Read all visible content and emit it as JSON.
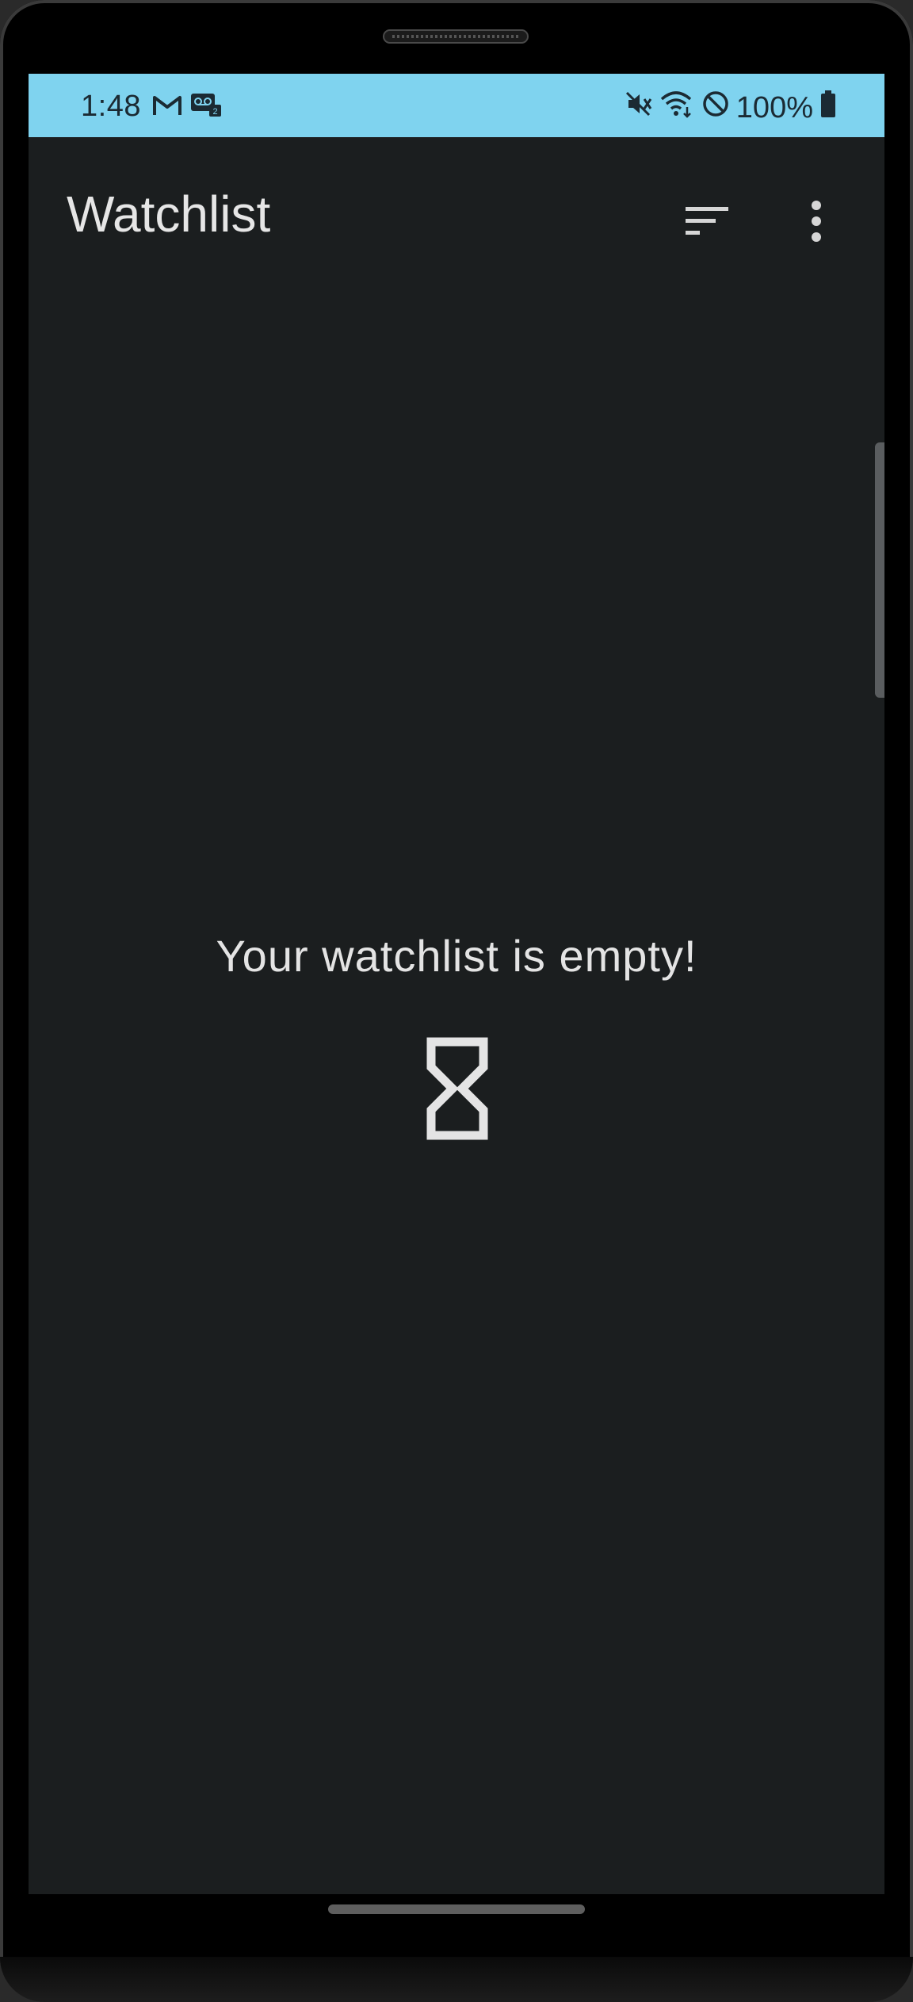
{
  "status_bar": {
    "time": "1:48",
    "battery": "100%",
    "left_icons": [
      "gmail-icon",
      "voicemail-icon"
    ],
    "right_icons": [
      "vibrate-off-icon",
      "wifi-icon",
      "do-not-disturb-icon",
      "battery-icon"
    ]
  },
  "app_bar": {
    "title": "Watchlist",
    "sort_icon": "sort-icon",
    "more_icon": "more-vert-icon"
  },
  "empty_state": {
    "message": "Your watchlist is empty!",
    "icon": "hourglass-icon"
  },
  "colors": {
    "status_bar_bg": "#7fd3ef",
    "background": "#1b1e1f",
    "text": "#e6e6e6"
  }
}
